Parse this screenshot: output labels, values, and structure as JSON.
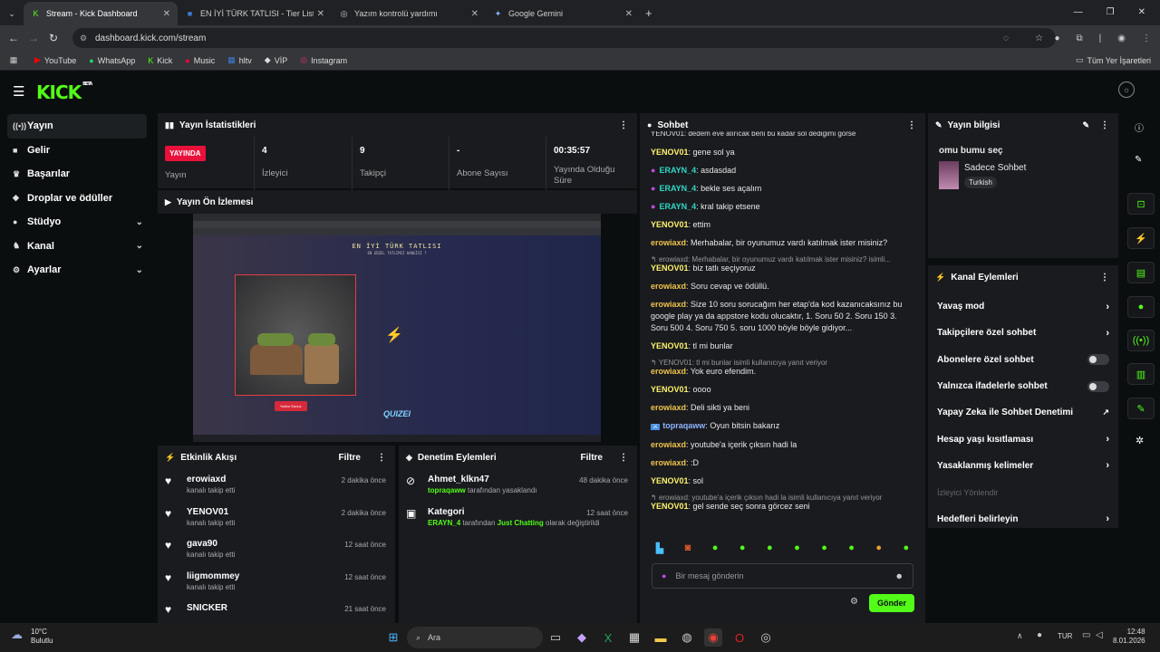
{
  "browser": {
    "tabs": [
      {
        "title": "Stream - Kick Dashboard",
        "fav": "K",
        "fav_color": "#53fc18"
      },
      {
        "title": "EN İYİ TÜRK TATLISI - Tier List,",
        "fav": "■",
        "fav_color": "#3d7ad6"
      },
      {
        "title": "Yazım kontrolü yardımı",
        "fav": "◎",
        "fav_color": "#cccccc"
      },
      {
        "title": "Google Gemini",
        "fav": "✦",
        "fav_color": "#8ab4f8"
      }
    ],
    "url": "dashboard.kick.com/stream",
    "bookmarks": [
      {
        "label": "YouTube",
        "icon": "▶",
        "color": "#ff0000"
      },
      {
        "label": "WhatsApp",
        "icon": "●",
        "color": "#25d366"
      },
      {
        "label": "Kick",
        "icon": "K",
        "color": "#53fc18"
      },
      {
        "label": "Music",
        "icon": "●",
        "color": "#ff0033"
      },
      {
        "label": "hltv",
        "icon": "▦",
        "color": "#3d7ad6"
      },
      {
        "label": "VİP",
        "icon": "◆",
        "color": "#dddddd"
      },
      {
        "label": "Instagram",
        "icon": "◎",
        "color": "#e1306c"
      }
    ],
    "all_bookmarks": "Tüm Yer İşaretleri"
  },
  "logo": {
    "text": "KICK",
    "beta": "BETA"
  },
  "sidebar": [
    {
      "label": "Yayın",
      "icon": "((•))",
      "chev": false
    },
    {
      "label": "Gelir",
      "icon": "■",
      "chev": false
    },
    {
      "label": "Başarılar",
      "icon": "♛",
      "chev": false
    },
    {
      "label": "Droplar ve ödüller",
      "icon": "◆",
      "chev": false
    },
    {
      "label": "Stüdyo",
      "icon": "●",
      "chev": true
    },
    {
      "label": "Kanal",
      "icon": "♞",
      "chev": true
    },
    {
      "label": "Ayarlar",
      "icon": "⚙",
      "chev": true
    }
  ],
  "stats": {
    "title": "Yayın İstatistikleri",
    "live_badge": "YAYINDA",
    "live_label": "Yayın",
    "viewers_value": "4",
    "viewers_label": "İzleyici",
    "followers_value": "9",
    "followers_label": "Takipçi",
    "subs_value": "-",
    "subs_label": "Abone Sayısı",
    "duration_value": "00:35:57",
    "duration_label": "Yayında Olduğu Süre"
  },
  "preview": {
    "title": "Yayın Ön İzlemesi",
    "inner_title": "EN İYİ TÜRK TATLISI",
    "inner_sub": "EN GÜZEL TATLIMIZ HANGİSİ ?",
    "inner_btn": "Yoktur Sonuc",
    "inner_logo": "QUIZEI"
  },
  "activity": {
    "title": "Etkinlik Akışı",
    "filter": "Filtre",
    "items": [
      {
        "name": "erowiaxd",
        "sub": "kanalı takip etti",
        "time": "2 dakika önce"
      },
      {
        "name": "YENOV01",
        "sub": "kanalı takip etti",
        "time": "2 dakika önce"
      },
      {
        "name": "gava90",
        "sub": "kanalı takip etti",
        "time": "12 saat önce"
      },
      {
        "name": "liigmommey",
        "sub": "kanalı takip etti",
        "time": "12 saat önce"
      },
      {
        "name": "SNICKER",
        "sub": "",
        "time": "21 saat önce"
      }
    ]
  },
  "moderation": {
    "title": "Denetim Eylemleri",
    "filter": "Filtre",
    "items": [
      {
        "name": "Ahmet_klkn47",
        "actor": "topraqaww",
        "rest": " tarafından yasaklandı",
        "extra": "",
        "tail": "",
        "time": "48 dakika önce"
      },
      {
        "name": "Kategori",
        "actor": "ERAYN_4",
        "rest": " tarafından ",
        "extra": "Just Chatting",
        "tail": " olarak değiştirildi",
        "time": "12 saat önce"
      }
    ]
  },
  "chat": {
    "title": "Sohbet",
    "messages": [
      {
        "user": "YENOV01",
        "color": "#fff36b",
        "text": "gene sol ya",
        "reply": ""
      },
      {
        "user": "ERAYN_4",
        "color": "#33d6c4",
        "text": "asdasdad",
        "reply": "",
        "mic": true
      },
      {
        "user": "ERAYN_4",
        "color": "#33d6c4",
        "text": "bekle ses açalım",
        "reply": "",
        "mic": true
      },
      {
        "user": "ERAYN_4",
        "color": "#33d6c4",
        "text": "kral takip etsene",
        "reply": "",
        "mic": true
      },
      {
        "user": "YENOV01",
        "color": "#fff36b",
        "text": "ettim",
        "reply": ""
      },
      {
        "user": "erowiaxd",
        "color": "#f0c24a",
        "text": "Merhabalar, bir oyunumuz vardı katılmak ister misiniz?",
        "reply": ""
      },
      {
        "user": "YENOV01",
        "color": "#fff36b",
        "text": "biz tatlı seçiyoruz",
        "reply": "erowiaxd: Merhabalar, bir oyunumuz vardı katılmak ister misiniz? isimli..."
      },
      {
        "user": "erowiaxd",
        "color": "#f0c24a",
        "text": "Soru cevap ve ödüllü.",
        "reply": ""
      },
      {
        "user": "erowiaxd",
        "color": "#f0c24a",
        "text": "Size 10 soru sorucağım her etap'da kod kazanıcaksınız bu google play ya da appstore kodu olucaktır, 1. Soru 50 2. Soru 150 3. Soru 500 4. Soru 750 5. soru 1000 böyle böyle gidiyor...",
        "reply": ""
      },
      {
        "user": "YENOV01",
        "color": "#fff36b",
        "text": "tl mi bunlar",
        "reply": ""
      },
      {
        "user": "erowiaxd",
        "color": "#f0c24a",
        "text": "Yok euro efendim.",
        "reply": "YENOV01: tl mi bunlar isimli kullanıcıya yanıt veriyor"
      },
      {
        "user": "YENOV01",
        "color": "#fff36b",
        "text": "oooo",
        "reply": ""
      },
      {
        "user": "erowiaxd",
        "color": "#f0c24a",
        "text": "Deli sikti ya beni",
        "reply": ""
      },
      {
        "user": "topraqaww",
        "color": "#8fb4ff",
        "text": "Oyun bitsin bakarız",
        "reply": "",
        "badge": true
      },
      {
        "user": "erowiaxd",
        "color": "#f0c24a",
        "text": "youtube'a içerik çıksın hadi la",
        "reply": ""
      },
      {
        "user": "erowiaxd",
        "color": "#f0c24a",
        "text": ":D",
        "reply": ""
      },
      {
        "user": "YENOV01",
        "color": "#fff36b",
        "text": "sol",
        "reply": ""
      },
      {
        "user": "YENOV01",
        "color": "#fff36b",
        "text": "gel sende seç sonra görcez seni",
        "reply": "erowiaxd: youtube'a içerik çıksın hadi la isimli kullanıcıya yanıt veriyor"
      }
    ],
    "top_cut": "YENOV01: dedem eve alırıcak beni bu kadar sol dediğimi görse",
    "placeholder": "Bir mesaj gönderin",
    "send": "Gönder"
  },
  "stream_info": {
    "title": "Yayın bilgisi",
    "stream_title": "omu bumu seç",
    "category": "Sadece Sohbet",
    "tag": "Turkish"
  },
  "channel_actions": {
    "title": "Kanal Eylemleri",
    "items": [
      {
        "label": "Yavaş mod",
        "kind": "chev"
      },
      {
        "label": "Takipçilere özel sohbet",
        "kind": "chev"
      },
      {
        "label": "Abonelere özel sohbet",
        "kind": "toggle"
      },
      {
        "label": "Yalnızca ifadelerle sohbet",
        "kind": "toggle"
      },
      {
        "label": "Yapay Zeka ile Sohbet Denetimi",
        "kind": "ext"
      },
      {
        "label": "Hesap yaşı kısıtlaması",
        "kind": "chev"
      },
      {
        "label": "Yasaklanmış kelimeler",
        "kind": "chev"
      },
      {
        "label": "İzleyici Yönlendir",
        "kind": "disabled"
      },
      {
        "label": "Hedefleri belirleyin",
        "kind": "chev"
      }
    ]
  },
  "taskbar": {
    "weather_temp": "10°C",
    "weather_desc": "Bulutlu",
    "search": "Ara",
    "lang": "TUR",
    "time": "12:48",
    "date": "8.01.2026"
  }
}
